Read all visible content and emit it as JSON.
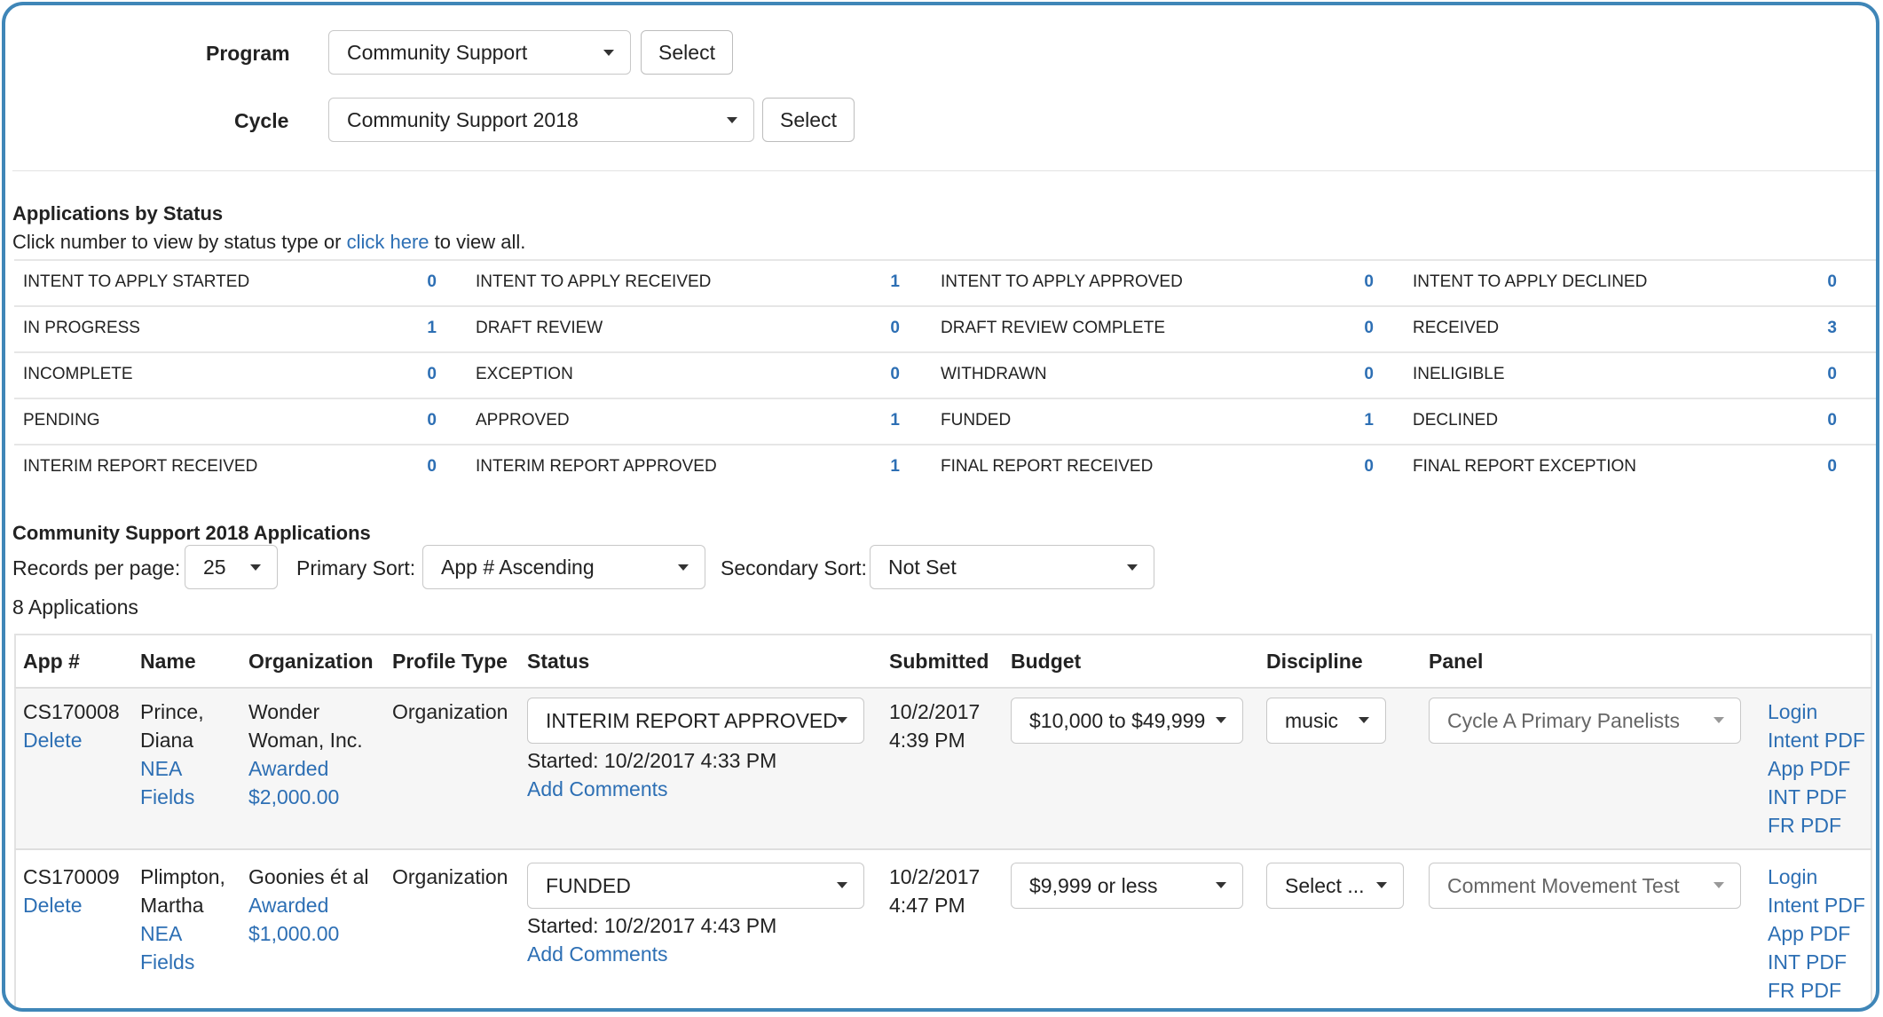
{
  "filters": {
    "program_label": "Program",
    "program_value": "Community Support",
    "program_button": "Select",
    "cycle_label": "Cycle",
    "cycle_value": "Community Support 2018",
    "cycle_button": "Select"
  },
  "status_section": {
    "title": "Applications by Status",
    "instructions_prefix": "Click number to view by status type or ",
    "instructions_link": "click here",
    "instructions_suffix": " to view all.",
    "rows": [
      [
        {
          "label": "INTENT TO APPLY STARTED",
          "count": "0"
        },
        {
          "label": "INTENT TO APPLY RECEIVED",
          "count": "1"
        },
        {
          "label": "INTENT TO APPLY APPROVED",
          "count": "0"
        },
        {
          "label": "INTENT TO APPLY DECLINED",
          "count": "0"
        }
      ],
      [
        {
          "label": "IN PROGRESS",
          "count": "1"
        },
        {
          "label": "DRAFT REVIEW",
          "count": "0"
        },
        {
          "label": "DRAFT REVIEW COMPLETE",
          "count": "0"
        },
        {
          "label": "RECEIVED",
          "count": "3"
        }
      ],
      [
        {
          "label": "INCOMPLETE",
          "count": "0"
        },
        {
          "label": "EXCEPTION",
          "count": "0"
        },
        {
          "label": "WITHDRAWN",
          "count": "0"
        },
        {
          "label": "INELIGIBLE",
          "count": "0"
        }
      ],
      [
        {
          "label": "PENDING",
          "count": "0"
        },
        {
          "label": "APPROVED",
          "count": "1"
        },
        {
          "label": "FUNDED",
          "count": "1"
        },
        {
          "label": "DECLINED",
          "count": "0"
        }
      ],
      [
        {
          "label": "INTERIM REPORT RECEIVED",
          "count": "0"
        },
        {
          "label": "INTERIM REPORT APPROVED",
          "count": "1"
        },
        {
          "label": "FINAL REPORT RECEIVED",
          "count": "0"
        },
        {
          "label": "FINAL REPORT EXCEPTION",
          "count": "0"
        }
      ]
    ]
  },
  "applications": {
    "title": "Community Support 2018 Applications",
    "records_label": "Records per page:",
    "records_value": "25",
    "primary_sort_label": "Primary Sort:",
    "primary_sort_value": "App # Ascending",
    "secondary_sort_label": "Secondary Sort:",
    "secondary_sort_value": "Not Set",
    "count_text": "8 Applications",
    "columns": {
      "app": "App #",
      "name": "Name",
      "organization": "Organization",
      "profile_type": "Profile Type",
      "status": "Status",
      "submitted": "Submitted",
      "budget": "Budget",
      "discipline": "Discipline",
      "panel": "Panel"
    },
    "rows": [
      {
        "app_id": "CS170008",
        "delete": "Delete",
        "name_line1": "Prince,",
        "name_line2": "Diana",
        "nea_link1": "NEA",
        "nea_link2": "Fields",
        "org_line1": "Wonder",
        "org_line2": "Woman, Inc.",
        "awarded": "Awarded",
        "amount": "$2,000.00",
        "profile_type": "Organization",
        "status": "INTERIM REPORT APPROVED",
        "started": "Started: 10/2/2017 4:33 PM",
        "add_comments": "Add Comments",
        "submitted_date": "10/2/2017",
        "submitted_time": "4:39 PM",
        "budget": "$10,000 to $49,999",
        "discipline": "music",
        "panel": "Cycle A Primary Panelists",
        "links": [
          "Login",
          "Intent PDF",
          "App PDF",
          "INT PDF",
          "FR PDF"
        ]
      },
      {
        "app_id": "CS170009",
        "delete": "Delete",
        "name_line1": "Plimpton,",
        "name_line2": "Martha",
        "nea_link1": "NEA",
        "nea_link2": "Fields",
        "org_line1": "Goonies ét al",
        "org_line2": "",
        "awarded": "Awarded",
        "amount": "$1,000.00",
        "profile_type": "Organization",
        "status": "FUNDED",
        "started": "Started: 10/2/2017 4:43 PM",
        "add_comments": "Add Comments",
        "submitted_date": "10/2/2017",
        "submitted_time": "4:47 PM",
        "budget": "$9,999 or less",
        "discipline": "Select ...",
        "panel": "Comment Movement Test",
        "links": [
          "Login",
          "Intent PDF",
          "App PDF",
          "INT PDF",
          "FR PDF"
        ]
      }
    ]
  }
}
